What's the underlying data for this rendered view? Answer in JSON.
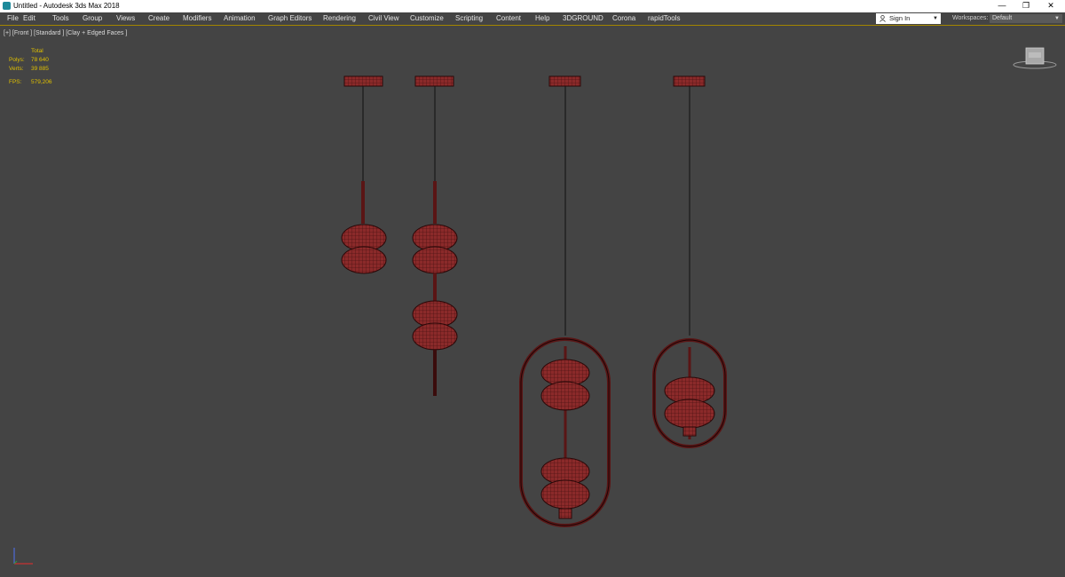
{
  "window": {
    "title": "Untitled - Autodesk 3ds Max 2018",
    "controls": {
      "minimize": "—",
      "restore": "❐",
      "close": "✕"
    }
  },
  "menubar": {
    "items": [
      {
        "label": "File",
        "w": 26
      },
      {
        "label": "Edit",
        "w": 33
      },
      {
        "label": "Tools",
        "w": 34
      },
      {
        "label": "Group",
        "w": 38
      },
      {
        "label": "Views",
        "w": 36
      },
      {
        "label": "Create",
        "w": 39
      },
      {
        "label": "Modifiers",
        "w": 46
      },
      {
        "label": "Animation",
        "w": 50
      },
      {
        "label": "Graph Editors",
        "w": 62
      },
      {
        "label": "Rendering",
        "w": 51
      },
      {
        "label": "Civil View",
        "w": 47
      },
      {
        "label": "Customize",
        "w": 51
      },
      {
        "label": "Scripting",
        "w": 46
      },
      {
        "label": "Content",
        "w": 44
      },
      {
        "label": "Help",
        "w": 31
      },
      {
        "label": "3DGROUND",
        "w": 56
      },
      {
        "label": "Corona",
        "w": 40
      },
      {
        "label": "rapidTools",
        "w": 50
      }
    ],
    "sign_in": "Sign In",
    "workspaces_label": "Workspaces:",
    "workspace_value": "Default",
    "accent": "#a38600"
  },
  "viewport": {
    "label": "[+] [Front ] [Standard ] [Clay + Edged Faces ]",
    "stats": {
      "header": "Total",
      "polys_label": "Polys:",
      "polys_value": "78 640",
      "verts_label": "Verts:",
      "verts_value": "39 885",
      "fps_label": "FPS:",
      "fps_value": "579,206"
    },
    "stats_color": "#e0c000",
    "background": "#444444",
    "model_color": "#8b2a2a",
    "wire_color": "#3a0c0c"
  }
}
